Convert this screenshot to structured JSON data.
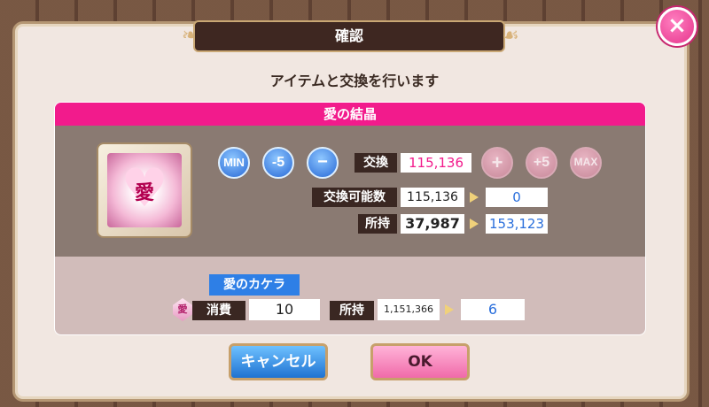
{
  "dialog": {
    "title": "確認",
    "subtitle": "アイテムと交換を行います",
    "close_label": "×"
  },
  "item": {
    "name": "愛の結晶",
    "icon_text": "愛",
    "icon": "heart-crystal-icon"
  },
  "controls": {
    "min": "MIN",
    "minus5": "-5",
    "minus": "−",
    "plus": "+",
    "plus5": "+5",
    "max": "MAX"
  },
  "exchange": {
    "label": "交換",
    "value": "115,136",
    "value_color": "#f21b8c"
  },
  "available": {
    "label": "交換可能数",
    "value": "115,136",
    "after": "0"
  },
  "owned": {
    "label": "所持",
    "value": "37,987",
    "after": "153,123"
  },
  "fragment": {
    "name": "愛のカケラ",
    "icon_text": "愛",
    "consume_label": "消費",
    "consume_value": "10",
    "owned_label": "所持",
    "owned_value": "1,151,366",
    "owned_after": "6"
  },
  "buttons": {
    "cancel": "キャンセル",
    "ok": "OK"
  }
}
